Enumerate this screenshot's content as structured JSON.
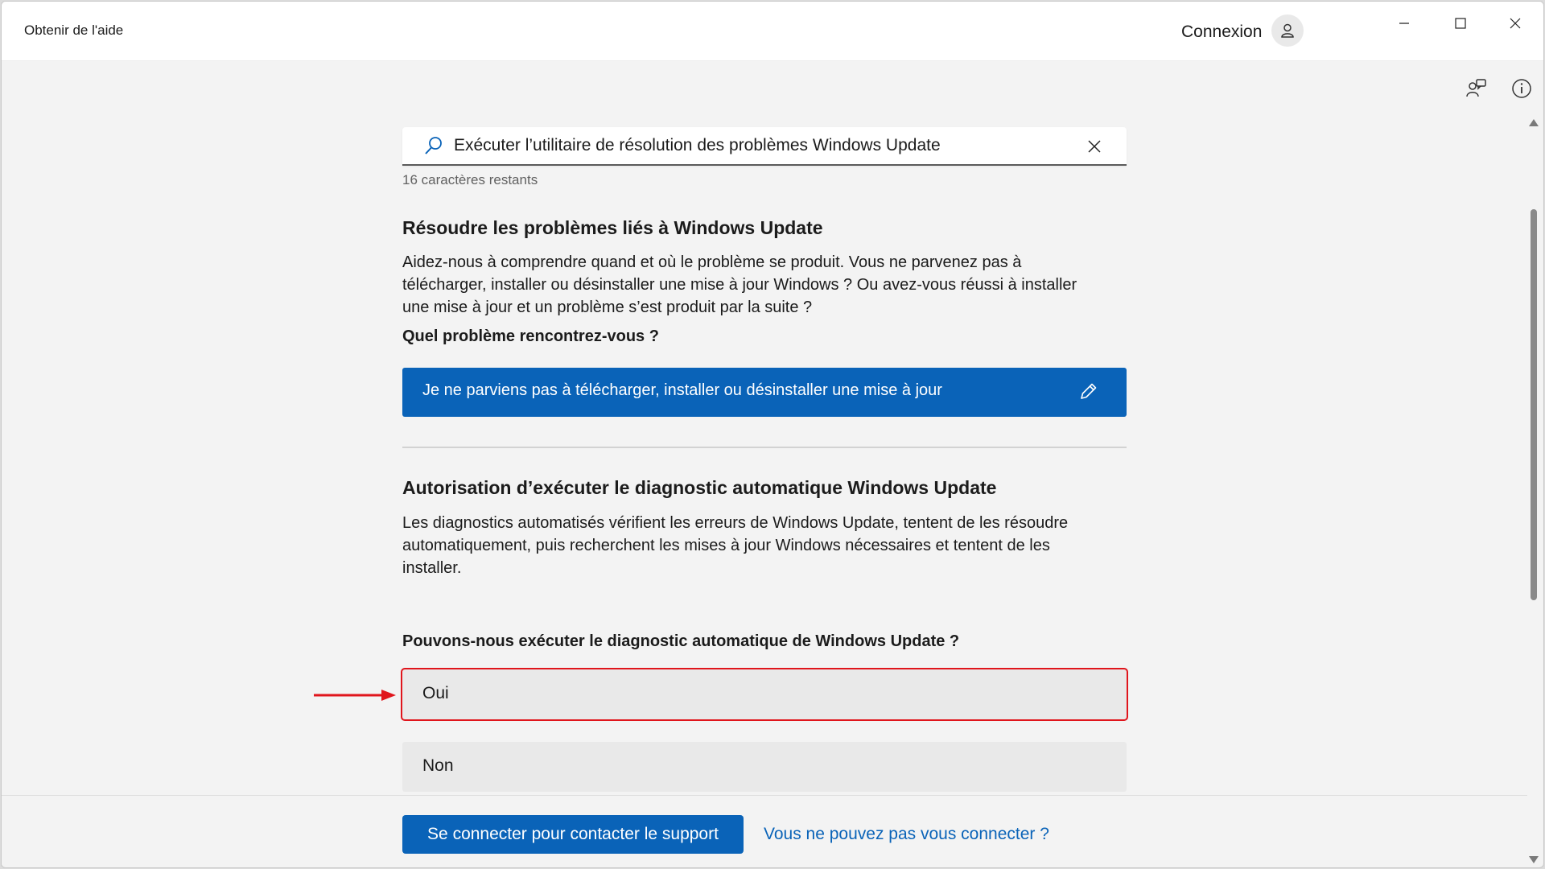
{
  "window": {
    "title": "Obtenir de l'aide",
    "signin_label": "Connexion",
    "controls": {
      "minimize_icon": "minimize-icon",
      "maximize_icon": "maximize-icon",
      "close_icon": "close-icon"
    }
  },
  "toolbar": {
    "contact_icon": "contact-support-icon",
    "about_icon": "info-icon"
  },
  "search": {
    "value": "Exécuter l’utilitaire de résolution des problèmes Windows Update",
    "chars_remaining": "16 caractères restants"
  },
  "section1": {
    "title": "Résoudre les problèmes liés à Windows Update",
    "body": "Aidez-nous à comprendre quand et où le problème se produit.  Vous ne parvenez pas à télécharger, installer ou désinstaller une mise à jour Windows ?  Ou avez-vous réussi à installer une mise à jour et un problème s’est produit par la suite ?",
    "question": "Quel problème rencontrez-vous ?",
    "selected_answer": "Je ne parviens pas à télécharger, installer ou désinstaller une mise à jour"
  },
  "section2": {
    "title": "Autorisation d’exécuter le diagnostic automatique Windows Update",
    "body": "Les diagnostics automatisés vérifient les erreurs de Windows Update, tentent de les résoudre automatiquement, puis recherchent les mises à jour Windows nécessaires et tentent de les installer.",
    "question": "Pouvons-nous exécuter le diagnostic automatique de Windows Update ?",
    "options": [
      "Oui",
      "Non"
    ]
  },
  "footer": {
    "contact_button": "Se connecter pour contacter le support",
    "cant_signin_link": "Vous ne pouvez pas vous connecter ?"
  },
  "colors": {
    "accent": "#0a63b8",
    "highlight": "#e0151c",
    "background": "#f3f3f3",
    "option_background": "#e9e9e9"
  }
}
